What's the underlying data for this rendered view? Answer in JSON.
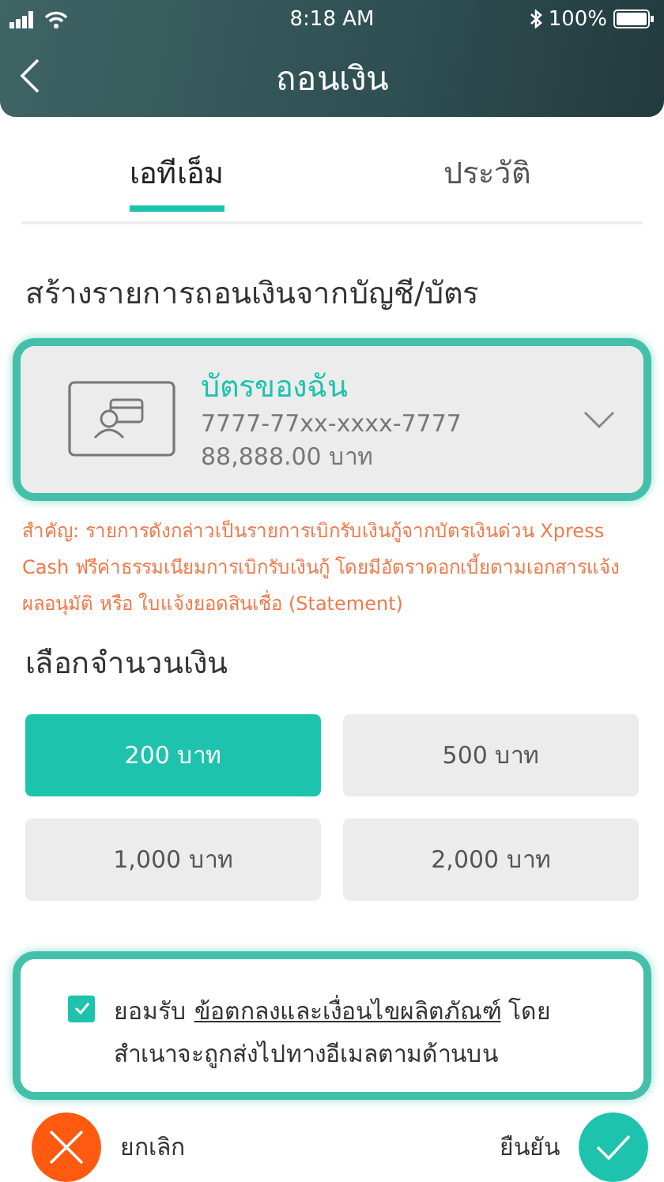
{
  "status_bar": {
    "time": "8:18 AM",
    "battery": "100%"
  },
  "nav": {
    "title": "ถอนเงิน"
  },
  "tabs": [
    {
      "label": "เอทีเอ็ม",
      "selected": true
    },
    {
      "label": "ประวัติ",
      "selected": false
    }
  ],
  "source_heading": "สร้างรายการถอนเงินจากบัญชี/บัตร",
  "card": {
    "name": "บัตรของฉัน",
    "number": "7777-77xx-xxxx-7777",
    "balance": "88,888.00 บาท"
  },
  "notice": "สำคัญ: รายการดังกล่าวเป็นรายการเบิกรับเงินกู้จากบัตรเงินด่วน Xpress Cash ฟรีค่าธรรมเนียมการเบิกรับเงินกู้ โดยมีอัตราดอกเบี้ยตามเอกสารแจ้งผลอนุมัติ หรือ ใบแจ้งยอดสินเชื่อ (Statement)",
  "amount_heading": "เลือกจำนวนเงิน",
  "amounts": [
    {
      "label": "200 บาท",
      "selected": true
    },
    {
      "label": "500 บาท",
      "selected": false
    },
    {
      "label": "1,000 บาท",
      "selected": false
    },
    {
      "label": "2,000 บาท",
      "selected": false
    }
  ],
  "agreement": {
    "checked": true,
    "prefix": "ยอมรับ",
    "link": "ข้อตกลงและเงื่อนไขผลิตภัณฑ์",
    "suffix": "โดยสำเนาจะถูกส่งไปทางอีเมลตามด้านบน"
  },
  "actions": {
    "cancel": "ยกเลิก",
    "confirm": "ยืนยัน"
  }
}
